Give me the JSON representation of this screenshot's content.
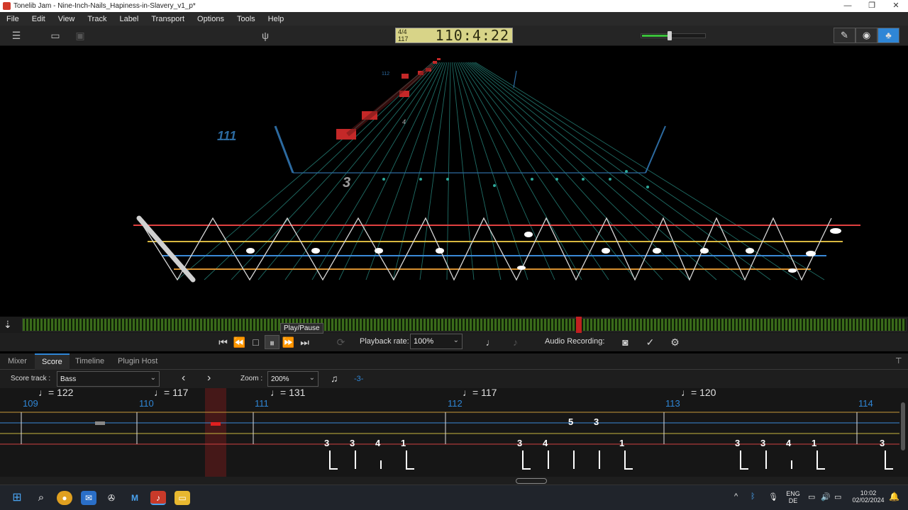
{
  "window": {
    "title": "Tonelib Jam - Nine-Inch-Nails_Hapiness-in-Slavery_v1_p*",
    "minimize": "—",
    "maximize": "❐",
    "close": "✕"
  },
  "menu": [
    "File",
    "Edit",
    "View",
    "Track",
    "Label",
    "Transport",
    "Options",
    "Tools",
    "Help"
  ],
  "lcd": {
    "time_signature": "4/4",
    "tempo": "117",
    "position": "110:4:22"
  },
  "volume": {
    "level": 0.42,
    "color": "#3cc13c"
  },
  "view_modes": [
    {
      "icon": "pencil-icon",
      "glyph": "✎",
      "active": false
    },
    {
      "icon": "eye-icon",
      "glyph": "◉",
      "active": false
    },
    {
      "icon": "people-icon",
      "glyph": "♣",
      "active": true
    }
  ],
  "stage": {
    "measure_label": "111",
    "triplet_label": "3",
    "far_measure": "112",
    "fret_4": "4"
  },
  "transport": {
    "tooltip": "Play/Pause",
    "playback_rate_label": "Playback rate:",
    "playback_rate_value": "100%",
    "audio_recording_label": "Audio Recording:"
  },
  "tabs": [
    {
      "label": "Mixer",
      "active": false
    },
    {
      "label": "Score",
      "active": true
    },
    {
      "label": "Timeline",
      "active": false
    },
    {
      "label": "Plugin Host",
      "active": false
    }
  ],
  "score_controls": {
    "score_track_label": "Score track :",
    "score_track_value": "Bass",
    "zoom_label": "Zoom :",
    "zoom_value": "200%",
    "tuplet": "-3-"
  },
  "score": {
    "measures": [
      {
        "number": "109",
        "tempo": "= 122"
      },
      {
        "number": "110",
        "tempo": "= 117"
      },
      {
        "number": "111",
        "tempo": "= 131"
      },
      {
        "number": "112",
        "tempo": "= 117"
      },
      {
        "number": "113",
        "tempo": "= 120"
      },
      {
        "number": "114",
        "tempo": ""
      }
    ],
    "string_3_frets": [
      "5",
      "3"
    ],
    "bottom_frets": [
      "3",
      "3",
      "4",
      "1",
      "3",
      "4",
      "1",
      "3",
      "3",
      "4",
      "1",
      "3"
    ]
  },
  "taskbar": {
    "language_1": "ENG",
    "language_2": "DE",
    "time": "10:02",
    "date": "02/02/2024"
  },
  "colors": {
    "accent": "#2f86d6",
    "string_red": "#e04040",
    "string_yellow": "#d8b840",
    "string_blue": "#3a8ad8",
    "string_orange": "#d89030",
    "fret_grid": "#2ea89a",
    "note_red": "#d83030"
  }
}
